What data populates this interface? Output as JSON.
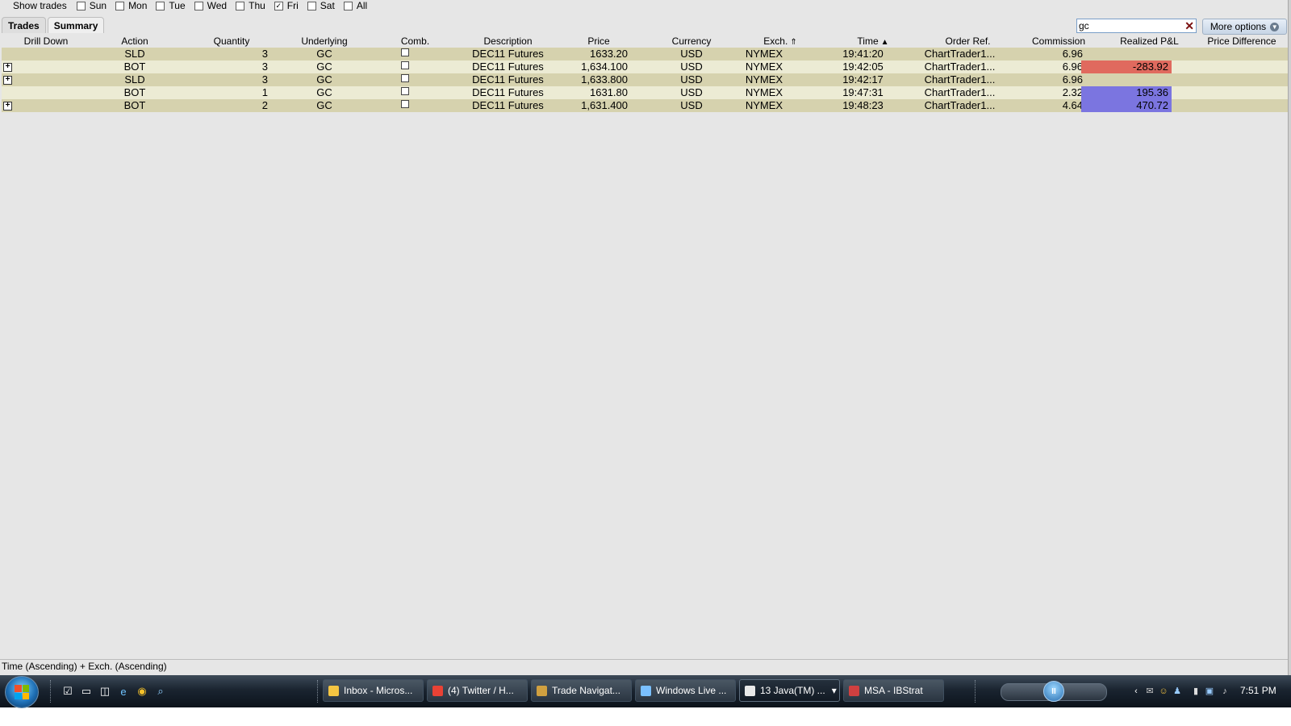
{
  "show_trades": {
    "label": "Show trades",
    "days": [
      {
        "label": "Sun",
        "checked": false
      },
      {
        "label": "Mon",
        "checked": false
      },
      {
        "label": "Tue",
        "checked": false
      },
      {
        "label": "Wed",
        "checked": false
      },
      {
        "label": "Thu",
        "checked": false
      },
      {
        "label": "Fri",
        "checked": true
      },
      {
        "label": "Sat",
        "checked": false
      },
      {
        "label": "All",
        "checked": false
      }
    ]
  },
  "tabs": [
    {
      "label": "Trades",
      "active": false
    },
    {
      "label": "Summary",
      "active": true
    }
  ],
  "search": {
    "value": "gc",
    "clear_icon": "close-icon"
  },
  "more_options": {
    "label": "More options",
    "icon": "chevron-down-circle-icon"
  },
  "columns": {
    "drill_down": "Drill Down",
    "action": "Action",
    "quantity": "Quantity",
    "underlying": "Underlying",
    "comb": "Comb.",
    "description": "Description",
    "price": "Price",
    "currency": "Currency",
    "exch": "Exch.",
    "time": "Time",
    "order_ref": "Order Ref.",
    "commission": "Commission",
    "realized_pnl": "Realized P&L",
    "price_difference": "Price Difference"
  },
  "colors": {
    "row_odd": "#d6d2ae",
    "row_even": "#ecebd4",
    "pnl_negative": "#e06a5e",
    "pnl_positive": "#7b75e0"
  },
  "rows": [
    {
      "expandable": false,
      "action": "SLD",
      "quantity": "3",
      "underlying": "GC",
      "comb": false,
      "description": "DEC11 Futures",
      "price": "1633.20",
      "currency": "USD",
      "exch": "NYMEX",
      "time": "19:41:20",
      "order_ref": "ChartTrader1...",
      "commission": "6.96",
      "realized_pnl": "",
      "pnl_sign": "none",
      "price_difference": ""
    },
    {
      "expandable": true,
      "action": "BOT",
      "quantity": "3",
      "underlying": "GC",
      "comb": false,
      "description": "DEC11 Futures",
      "price": "1,634.100",
      "currency": "USD",
      "exch": "NYMEX",
      "time": "19:42:05",
      "order_ref": "ChartTrader1...",
      "commission": "6.96",
      "realized_pnl": "-283.92",
      "pnl_sign": "negative",
      "price_difference": ""
    },
    {
      "expandable": true,
      "action": "SLD",
      "quantity": "3",
      "underlying": "GC",
      "comb": false,
      "description": "DEC11 Futures",
      "price": "1,633.800",
      "currency": "USD",
      "exch": "NYMEX",
      "time": "19:42:17",
      "order_ref": "ChartTrader1...",
      "commission": "6.96",
      "realized_pnl": "",
      "pnl_sign": "none",
      "price_difference": ""
    },
    {
      "expandable": false,
      "action": "BOT",
      "quantity": "1",
      "underlying": "GC",
      "comb": false,
      "description": "DEC11 Futures",
      "price": "1631.80",
      "currency": "USD",
      "exch": "NYMEX",
      "time": "19:47:31",
      "order_ref": "ChartTrader1...",
      "commission": "2.32",
      "realized_pnl": "195.36",
      "pnl_sign": "positive",
      "price_difference": ""
    },
    {
      "expandable": true,
      "action": "BOT",
      "quantity": "2",
      "underlying": "GC",
      "comb": false,
      "description": "DEC11 Futures",
      "price": "1,631.400",
      "currency": "USD",
      "exch": "NYMEX",
      "time": "19:48:23",
      "order_ref": "ChartTrader1...",
      "commission": "4.64",
      "realized_pnl": "470.72",
      "pnl_sign": "positive",
      "price_difference": ""
    }
  ],
  "status_bar": {
    "text": "Time (Ascending) + Exch. (Ascending)"
  },
  "taskbar": {
    "quick_launch": [
      "show-desktop-icon",
      "computer-icon",
      "window-switch-icon",
      "internet-explorer-icon",
      "chrome-icon",
      "search-icon"
    ],
    "tasks": [
      {
        "label": "Inbox - Micros...",
        "icon": "outlook-icon",
        "active": false
      },
      {
        "label": "(4) Twitter / H...",
        "icon": "chrome-icon",
        "active": false
      },
      {
        "label": "Trade Navigat...",
        "icon": "trade-navigator-icon",
        "active": false
      },
      {
        "label": "Windows Live ...",
        "icon": "windows-live-icon",
        "active": false
      },
      {
        "label": "13 Java(TM) ...",
        "icon": "java-icon",
        "active": true
      },
      {
        "label": "MSA - IBStrat",
        "icon": "ibstrat-icon",
        "active": false
      }
    ],
    "clock": "7:51 PM"
  }
}
